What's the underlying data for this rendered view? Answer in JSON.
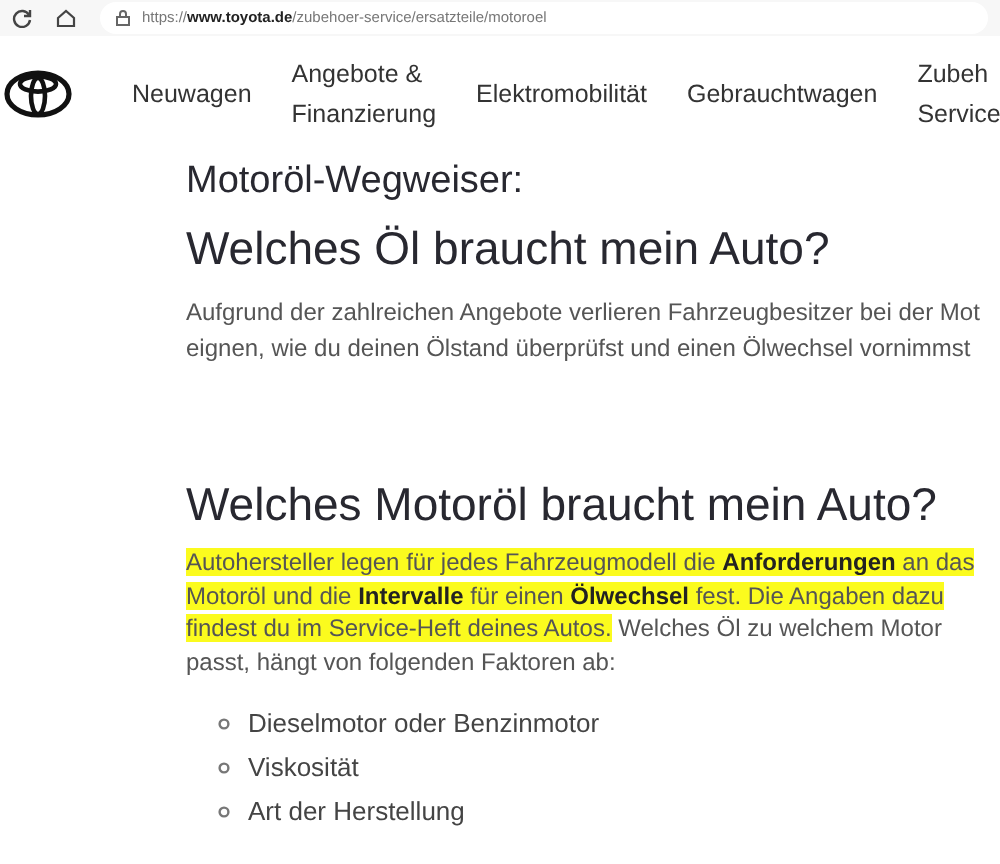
{
  "browser": {
    "url_prefix": "https://",
    "url_domain": "www.toyota.de",
    "url_path": "/zubehoer-service/ersatzteile/motoroel"
  },
  "nav": {
    "items": [
      {
        "lines": [
          "Neuwagen"
        ]
      },
      {
        "lines": [
          "Angebote &",
          "Finanzierung"
        ]
      },
      {
        "lines": [
          "Elektromobilität"
        ]
      },
      {
        "lines": [
          "Gebrauchtwagen"
        ]
      },
      {
        "lines": [
          "Zubeh",
          "Service"
        ]
      }
    ]
  },
  "article": {
    "title": "Motoröl-Wegweiser:",
    "subtitle": "Welches Öl braucht mein Auto?",
    "intro_lines": [
      "Aufgrund der zahlreichen Angebote verlieren Fahrzeugbesitzer bei der Mot",
      "eignen, wie du deinen Ölstand überprüfst und einen Ölwechsel vornimmst"
    ],
    "section_title": "Welches Motoröl braucht mein Auto?",
    "paragraph_lines": [
      [
        {
          "text": "Autohersteller legen für jedes Fahrzeugmodell die **Anforderungen** an das",
          "highlighted": true
        }
      ],
      [
        {
          "text": "Motoröl und die **Intervalle** für einen **Ölwechsel** fest. Die Angaben dazu",
          "highlighted": true
        }
      ],
      [
        {
          "text": "findest du im Service-Heft deines Autos.",
          "highlighted": true
        },
        {
          "text": " Welches Öl zu welchem Motor",
          "highlighted": false
        }
      ],
      [
        {
          "text": "passt, hängt von folgenden Faktoren ab:",
          "highlighted": false
        }
      ]
    ],
    "factors": [
      "Dieselmotor oder Benzinmotor",
      "Viskosität",
      "Art der Herstellung"
    ]
  }
}
